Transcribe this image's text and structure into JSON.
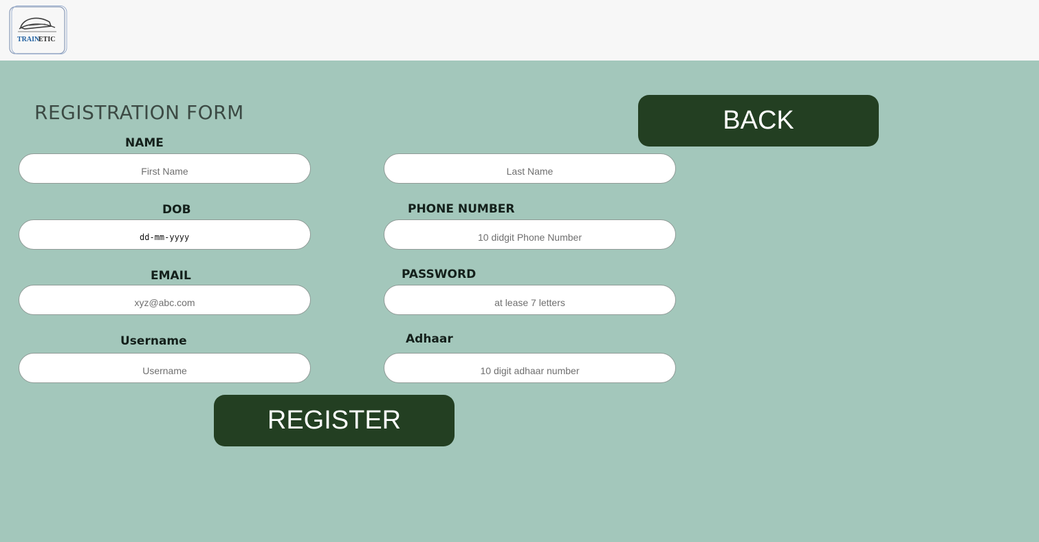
{
  "brand": {
    "logo_text_blue": "TRAIN",
    "logo_text_dark": "ETIC",
    "logo_icon": "train-logo-icon"
  },
  "form": {
    "title": "REGISTRATION FORM",
    "back_label": "BACK",
    "register_label": "REGISTER",
    "fields": {
      "name_label": "NAME",
      "first_name_placeholder": "First Name",
      "last_name_placeholder": "Last Name",
      "dob_label": "DOB",
      "dob_value": "dd-mm-yyyy",
      "phone_label": "PHONE NUMBER",
      "phone_placeholder": "10 didgit Phone Number",
      "email_label": "EMAIL",
      "email_placeholder": "xyz@abc.com",
      "password_label": "PASSWORD",
      "password_placeholder": "at lease 7 letters",
      "username_label": "Username",
      "username_placeholder": "Username",
      "adhaar_label": "Adhaar",
      "adhaar_placeholder": "10 digit adhaar number"
    }
  },
  "colors": {
    "header_bg": "#f7f7f7",
    "main_bg": "#a3c7bb",
    "button_bg": "#233f22",
    "button_text": "#ffffff"
  }
}
